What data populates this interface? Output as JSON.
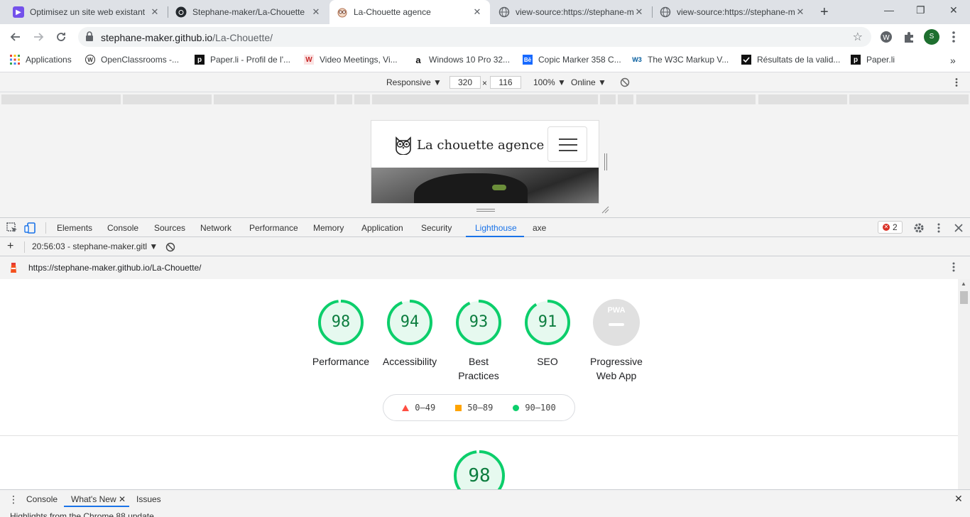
{
  "browser": {
    "tabs": [
      {
        "title": "Optimisez un site web existant",
        "favicon": "openclassrooms-icon",
        "color": "#7451eb"
      },
      {
        "title": "Stephane-maker/La-Chouette",
        "favicon": "github-icon",
        "color": "#24292e"
      },
      {
        "title": "La-Chouette agence",
        "favicon": "owl-icon",
        "color": "#f0e0d0"
      },
      {
        "title": "view-source:https://stephane-m",
        "favicon": "globe-icon",
        "color": "#5f6368"
      },
      {
        "title": "view-source:https://stephane-m",
        "favicon": "globe-icon",
        "color": "#5f6368"
      }
    ],
    "close_glyph": "✕",
    "newtab_glyph": "+",
    "window_controls": [
      "—",
      "❐",
      "✕"
    ],
    "address": {
      "host": "stephane-maker.github.io",
      "path": "/La-Chouette/"
    },
    "profile_initial": "S",
    "bookmarks": [
      {
        "label": "Applications",
        "icon": "apps-grid-icon"
      },
      {
        "label": "OpenClassrooms -...",
        "icon": "openclassrooms-icon",
        "glyph": "W"
      },
      {
        "label": "Paper.li - Profil de l'...",
        "icon": "paperli-icon",
        "glyph": "p"
      },
      {
        "label": "Video Meetings, Vi...",
        "icon": "whereby-icon",
        "glyph": "W"
      },
      {
        "label": "Windows 10 Pro 32...",
        "icon": "amazon-icon",
        "glyph": "a"
      },
      {
        "label": "Copic Marker 358 C...",
        "icon": "behance-icon",
        "glyph": "Bē"
      },
      {
        "label": "The W3C Markup V...",
        "icon": "w3c-icon",
        "glyph": "W3"
      },
      {
        "label": "Résultats de la valid...",
        "icon": "validator-icon",
        "glyph": ""
      },
      {
        "label": "Paper.li",
        "icon": "paperli-icon",
        "glyph": "p"
      }
    ],
    "bookmarks_more": "»"
  },
  "device_toolbar": {
    "mode": "Responsive ▼",
    "width": "320",
    "times": "×",
    "height": "116",
    "zoom": "100% ▼",
    "network": "Online ▼"
  },
  "site": {
    "brand": "La chouette agence"
  },
  "devtools": {
    "tabs": [
      "Elements",
      "Console",
      "Sources",
      "Network",
      "Performance",
      "Memory",
      "Application",
      "Security",
      "Lighthouse",
      "axe"
    ],
    "active_tab": "Lighthouse",
    "error_count": "2",
    "report_selector": "20:56:03 - stephane-maker.gitl ▼",
    "plus": "+",
    "report_url": "https://stephane-maker.github.io/La-Chouette/"
  },
  "lighthouse": {
    "scores": [
      {
        "label1": "Performance",
        "label2": "",
        "score": 98
      },
      {
        "label1": "Accessibility",
        "label2": "",
        "score": 94
      },
      {
        "label1": "Best",
        "label2": "Practices",
        "score": 93
      },
      {
        "label1": "SEO",
        "label2": "",
        "score": 91
      }
    ],
    "pwa": {
      "label1": "Progressive",
      "label2": "Web App",
      "badge": "PWA"
    },
    "legend": [
      "0–49",
      "50–89",
      "90–100"
    ],
    "featured_score": 98,
    "colors": {
      "pass": "#0cce6b",
      "average": "#ffa400",
      "fail": "#ff4e42"
    }
  },
  "drawer": {
    "menu": "⋮",
    "tabs": [
      "Console",
      "What's New",
      "Issues"
    ],
    "tab_close": "✕",
    "active_tab": "What's New",
    "content": "Highlights from the Chrome 88 update",
    "close": "✕"
  }
}
